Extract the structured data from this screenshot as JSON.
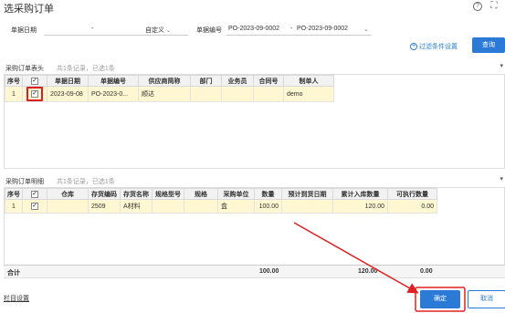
{
  "dialog": {
    "title": "选采购订单"
  },
  "filters": {
    "date_label": "单据日期",
    "date_separator": "-",
    "date_mode": "自定义",
    "doc_no_label": "单据编号",
    "doc_no_from": "PO-2023-09-0002",
    "doc_no_to": "PO-2023-09-0002",
    "doc_no_separator": "-",
    "advanced_label": "过滤条件设置",
    "query_label": "查询"
  },
  "header_panel": {
    "title": "采购订单表头",
    "summary": "共1条记录，已选1条",
    "columns": [
      "序号",
      "",
      "单据日期",
      "单据编号",
      "供应商简称",
      "部门",
      "业务员",
      "合同号",
      "制单人"
    ],
    "rows": [
      {
        "seq": "1",
        "checked": "✓",
        "date": "2023-09-08",
        "doc_no": "PO-2023-0...",
        "supplier": "顺达",
        "dept": "",
        "clerk": "",
        "contract": "",
        "maker": "demo"
      }
    ]
  },
  "detail_panel": {
    "title": "采购订单明细",
    "summary": "共1条记录，已选1条",
    "columns": [
      "序号",
      "",
      "仓库",
      "存货编码",
      "存货名称",
      "规格型号",
      "规格",
      "采购单位",
      "数量",
      "预计到货日期",
      "累计入库数量",
      "可执行数量"
    ],
    "rows": [
      {
        "seq": "1",
        "checked": "✓",
        "warehouse": "",
        "code": "2509",
        "name": "A材料",
        "model": "",
        "spec": "",
        "unit": "盒",
        "qty": "100.00",
        "eta": "",
        "received": "120.00",
        "executable": "0.00"
      }
    ],
    "totals": {
      "label": "合计",
      "qty": "100.00",
      "received": "120.00",
      "executable": "0.00"
    }
  },
  "footer": {
    "column_settings": "栏目设置",
    "ok_label": "确定",
    "cancel_label": "取消"
  },
  "colors": {
    "primary": "#2b7bd6",
    "selected_row": "#fff7d1",
    "annotation_red": "#e02020"
  }
}
